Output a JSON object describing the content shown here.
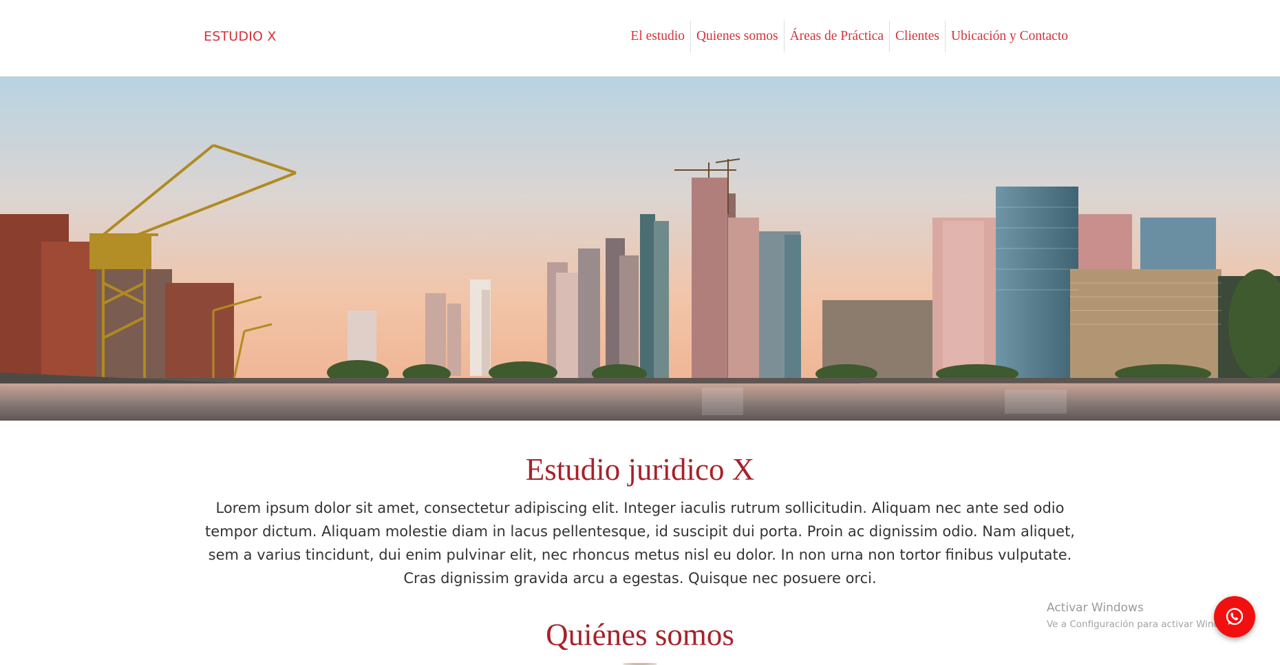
{
  "header": {
    "brand": "ESTUDIO X",
    "nav": [
      {
        "label": "El estudio"
      },
      {
        "label": "Quienes somos"
      },
      {
        "label": "Áreas de Práctica"
      },
      {
        "label": "Clientes"
      },
      {
        "label": "Ubicación y Contacto"
      }
    ]
  },
  "hero": {
    "icon": "city-skyline-image"
  },
  "main": {
    "title": "Estudio juridico X",
    "intro": "Lorem ipsum dolor sit amet, consectetur adipiscing elit. Integer iaculis rutrum sollicitudin. Aliquam nec ante sed odio tempor dictum. Aliquam molestie diam in lacus pellentesque, id suscipit dui porta. Proin ac dignissim odio. Nam aliquet, sem a varius tincidunt, dui enim pulvinar elit, nec rhoncus metus nisl eu dolor. In non urna non tortor finibus vulputate. Cras dignissim gravida arcu a egestas. Quisque nec posuere orci.",
    "section_title": "Quiénes somos"
  },
  "watermark": {
    "title": "Activar Windows",
    "subtitle": "Ve a Configuración para activar Windows."
  },
  "whatsapp": {
    "icon": "whatsapp-icon"
  },
  "colors": {
    "accent": "#d4323a",
    "heading": "#a7222a",
    "whatsapp_button": "#f20f0f"
  }
}
